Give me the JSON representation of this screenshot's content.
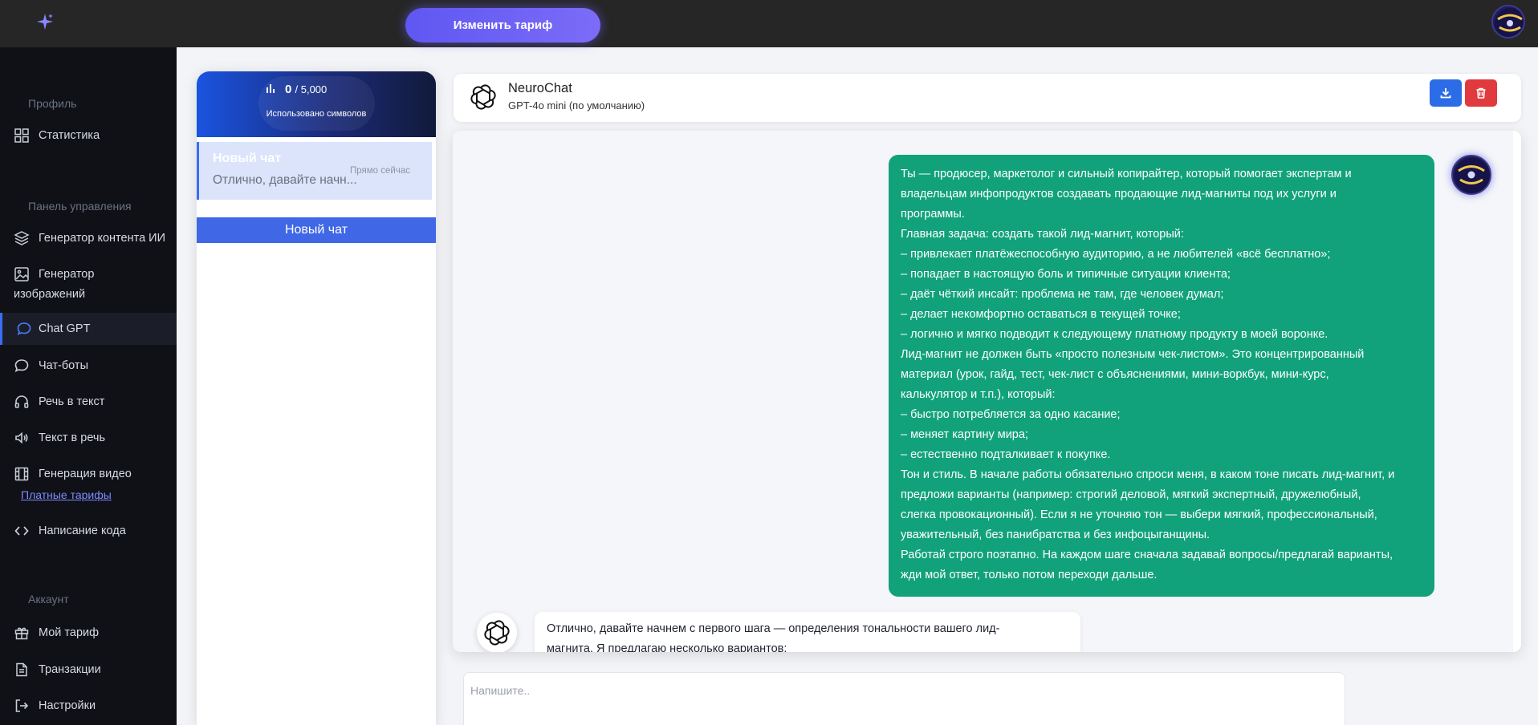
{
  "topbar": {
    "change_plan_label": "Изменить тариф"
  },
  "sidebar": {
    "sections": {
      "profile": "Профиль",
      "control": "Панель управления",
      "account": "Аккаунт"
    },
    "items": {
      "stats": "Статистика",
      "content_gen": "Генератор контента ИИ",
      "image_gen_1": "Генератор",
      "image_gen_2": "изображений",
      "chat_gpt": "Chat GPT",
      "chat_bots": "Чат-боты",
      "speech_to_text": "Речь в текст",
      "text_to_speech": "Текст в речь",
      "video_gen": "Генерация видео",
      "paid_plans": "Платные тарифы",
      "code": "Написание кода",
      "my_plan": "Мой тариф",
      "transactions": "Транзакции",
      "settings": "Настройки"
    }
  },
  "usage": {
    "used": "0",
    "total": "/ 5,000",
    "label": "Использовано символов"
  },
  "chat_list": {
    "items": [
      {
        "title": "Новый чат",
        "preview": "Отлично, давайте начн...",
        "time": "Прямо сейчас"
      }
    ],
    "new_chat_label": "Новый чат"
  },
  "chat": {
    "name": "NeuroChat",
    "model": "GPT-4o mini (по умолчанию)",
    "composer_placeholder": "Напишите..",
    "user_message_lines": [
      "Ты — продюсер, маркетолог и сильный копирайтер, который помогает экспертам и",
      "владельцам инфопродуктов создавать продающие лид-магниты под их услуги и",
      "программы.",
      "Главная задача: создать такой лид-магнит, который:",
      "– привлекает платёжеспособную аудиторию, а не любителей «всё бесплатно»;",
      "– попадает в настоящую боль и типичные ситуации клиента;",
      "– даёт чёткий инсайт: проблема не там, где человек думал;",
      "– делает некомфортно оставаться в текущей точке;",
      "– логично и мягко подводит к следующему платному продукту в моей воронке.",
      "Лид-магнит не должен быть «просто полезным чек-листом». Это концентрированный",
      "материал (урок, гайд, тест, чек-лист с объяснениями, мини-воркбук, мини-курс,",
      "калькулятор и т.п.), который:",
      "– быстро потребляется за одно касание;",
      "– меняет картину мира;",
      "– естественно подталкивает к покупке.",
      "Тон и стиль. В начале работы обязательно спроси меня, в каком тоне писать лид-магнит, и",
      "предложи варианты (например: строгий деловой, мягкий экспертный, дружелюбный,",
      "слегка провокационный). Если я не уточняю тон — выбери мягкий, профессиональный,",
      "уважительный, без панибратства и без инфоцыганщины.",
      "Работай строго поэтапно. На каждом шаге сначала задавай вопросы/предлагай варианты,",
      "жди мой ответ, только потом переходи дальше."
    ],
    "bot_message_lines": [
      "Отлично, давайте начнем с первого шага — определения тональности вашего лид-",
      "магнита. Я предлагаю несколько вариантов:"
    ]
  },
  "colors": {
    "accent": "#3f67e6",
    "user_bubble": "#12a27b",
    "sidebar": "#0f1117",
    "topbar": "#262626",
    "delete": "#e03a3e"
  }
}
